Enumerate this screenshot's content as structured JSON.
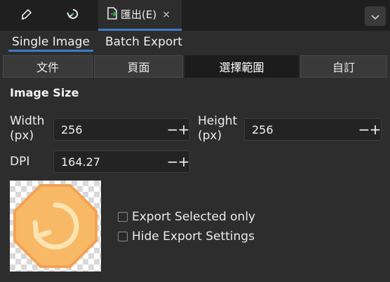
{
  "dock": {
    "tabs": [
      {
        "icon": "pen-edit-icon"
      },
      {
        "icon": "reload-icon"
      },
      {
        "icon": "export-document-icon",
        "label": "匯出(E)",
        "close": "×"
      }
    ],
    "menu_icon": "chevron-down-icon"
  },
  "sub_tabs": {
    "single": "Single Image",
    "batch": "Batch Export"
  },
  "segments": [
    "文件",
    "頁面",
    "選擇範圍",
    "自訂"
  ],
  "active_segment": "選擇範圍",
  "image_size": {
    "title": "Image Size",
    "width_label": "Width\n(px)",
    "width_value": "256",
    "height_label": "Height\n(px)",
    "height_value": "256",
    "dpi_label": "DPI",
    "dpi_value": "164.27",
    "minus": "−",
    "plus": "+"
  },
  "options": {
    "export_selected": "Export Selected only",
    "hide_settings": "Hide Export Settings"
  },
  "preview": {
    "shape": "orange-octagon-reload-icon",
    "colors": {
      "fill": "#f8b966",
      "stroke": "#f4a155",
      "arrow": "#fde4b3"
    }
  }
}
